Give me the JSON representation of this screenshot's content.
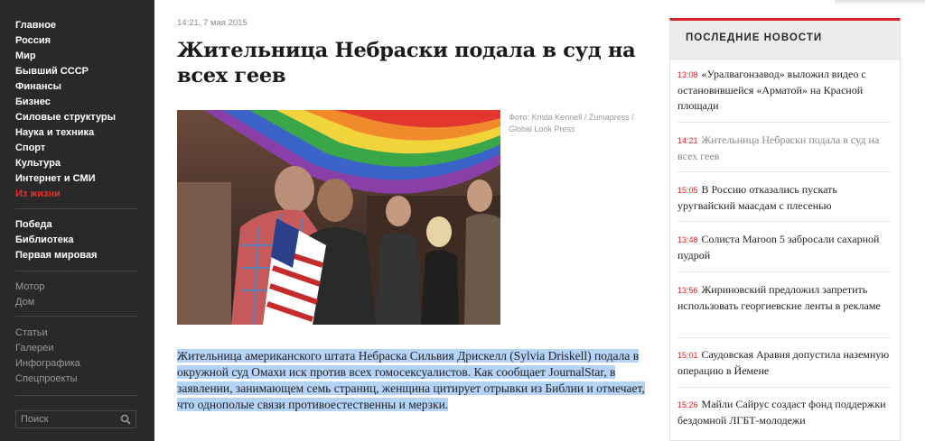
{
  "sidebar": {
    "main_nav": [
      {
        "label": "Главное"
      },
      {
        "label": "Россия"
      },
      {
        "label": "Мир"
      },
      {
        "label": "Бывший СССР"
      },
      {
        "label": "Финансы"
      },
      {
        "label": "Бизнес"
      },
      {
        "label": "Силовые структуры"
      },
      {
        "label": "Наука и техника"
      },
      {
        "label": "Спорт"
      },
      {
        "label": "Культура"
      },
      {
        "label": "Интернет и СМИ"
      },
      {
        "label": "Из жизни"
      }
    ],
    "special_nav": [
      {
        "label": "Победа"
      },
      {
        "label": "Библиотека"
      },
      {
        "label": "Первая мировая"
      }
    ],
    "project_nav": [
      {
        "label": "Мотор"
      },
      {
        "label": "Дом"
      }
    ],
    "content_nav": [
      {
        "label": "Статьи"
      },
      {
        "label": "Галереи"
      },
      {
        "label": "Инфографика"
      },
      {
        "label": "Спецпроекты"
      }
    ],
    "search": {
      "placeholder": "Поиск"
    }
  },
  "article": {
    "timestamp": "14:21, 7 мая 2015",
    "headline": "Жительница Небраски подала в суд на всех геев",
    "photo_credit": "Фото: Krista Kennell / Zumapress / Global Look Press",
    "lead": "Жительница американского штата Небраска Сильвия Дрискелл (Sylvia Driskell) подала в окружной суд Омахи иск против всех гомосексуалистов. Как сообщает JournalStar, в заявлении, занимающем семь страниц, женщина цитирует отрывки из Библии и отмечает, что однополые связи противоестественны и мерзки."
  },
  "latest_news": {
    "title": "ПОСЛЕДНИЕ НОВОСТИ",
    "items": [
      {
        "time": "13:08",
        "text": "«Уралвагонзавод» выложил видео с остановившейся «Арматой» на Красной площади"
      },
      {
        "time": "14:21",
        "text": "Жительница Небраски подала в суд на всех геев"
      },
      {
        "time": "15:05",
        "text": "В Россию отказались пускать уругвайский маасдам с плесенью"
      },
      {
        "time": "13:48",
        "text": "Солиста Maroon 5 забросали сахарной пудрой"
      },
      {
        "time": "13:56",
        "text": "Жириновский предложил запретить использовать георгиевские ленты в рекламе"
      },
      {
        "time": "15:01",
        "text": "Саудовская Аравия допустила наземную операцию в Йемене"
      },
      {
        "time": "15:26",
        "text": "Майли Сайрус создаст фонд поддержки бездомной ЛГБТ-молодежи"
      }
    ]
  },
  "colors": {
    "accent": "#d8242a",
    "sidebar_bg": "#292929",
    "selection": "#b4d3f7"
  }
}
